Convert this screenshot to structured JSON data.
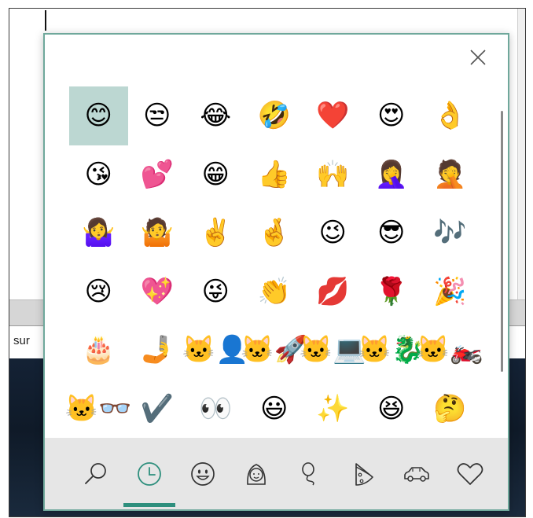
{
  "background": {
    "text": "sur"
  },
  "emoji_panel": {
    "close_icon": "close-icon",
    "accent_color": "#2e8f7d",
    "grid": [
      [
        "😊",
        "😒",
        "😂",
        "🤣",
        "❤️",
        "😍",
        "👌"
      ],
      [
        "😘",
        "💕",
        "😁",
        "👍",
        "🙌",
        "🤦‍♀️",
        "🤦"
      ],
      [
        "🤷‍♀️",
        "🤷",
        "✌️",
        "🤞",
        "😉",
        "😎",
        "🎶"
      ],
      [
        "😢",
        "💖",
        "😜",
        "👏",
        "💋",
        "🌹",
        "🎉"
      ],
      [
        "🎂",
        "🤳",
        "🐱‍👤",
        "🐱‍🚀",
        "🐱‍💻",
        "🐱‍🐉",
        "🐱‍🏍"
      ],
      [
        "🐱‍👓",
        "✔️",
        "👀",
        "😃",
        "✨",
        "😆",
        "🤔"
      ]
    ],
    "selected_emoji": "😊",
    "categories": [
      {
        "icon": "search-icon"
      },
      {
        "icon": "recent-clock-icon",
        "selected": true
      },
      {
        "icon": "smiley-icon"
      },
      {
        "icon": "person-icon"
      },
      {
        "icon": "balloon-icon"
      },
      {
        "icon": "pizza-icon"
      },
      {
        "icon": "car-icon"
      },
      {
        "icon": "heart-icon"
      }
    ]
  }
}
